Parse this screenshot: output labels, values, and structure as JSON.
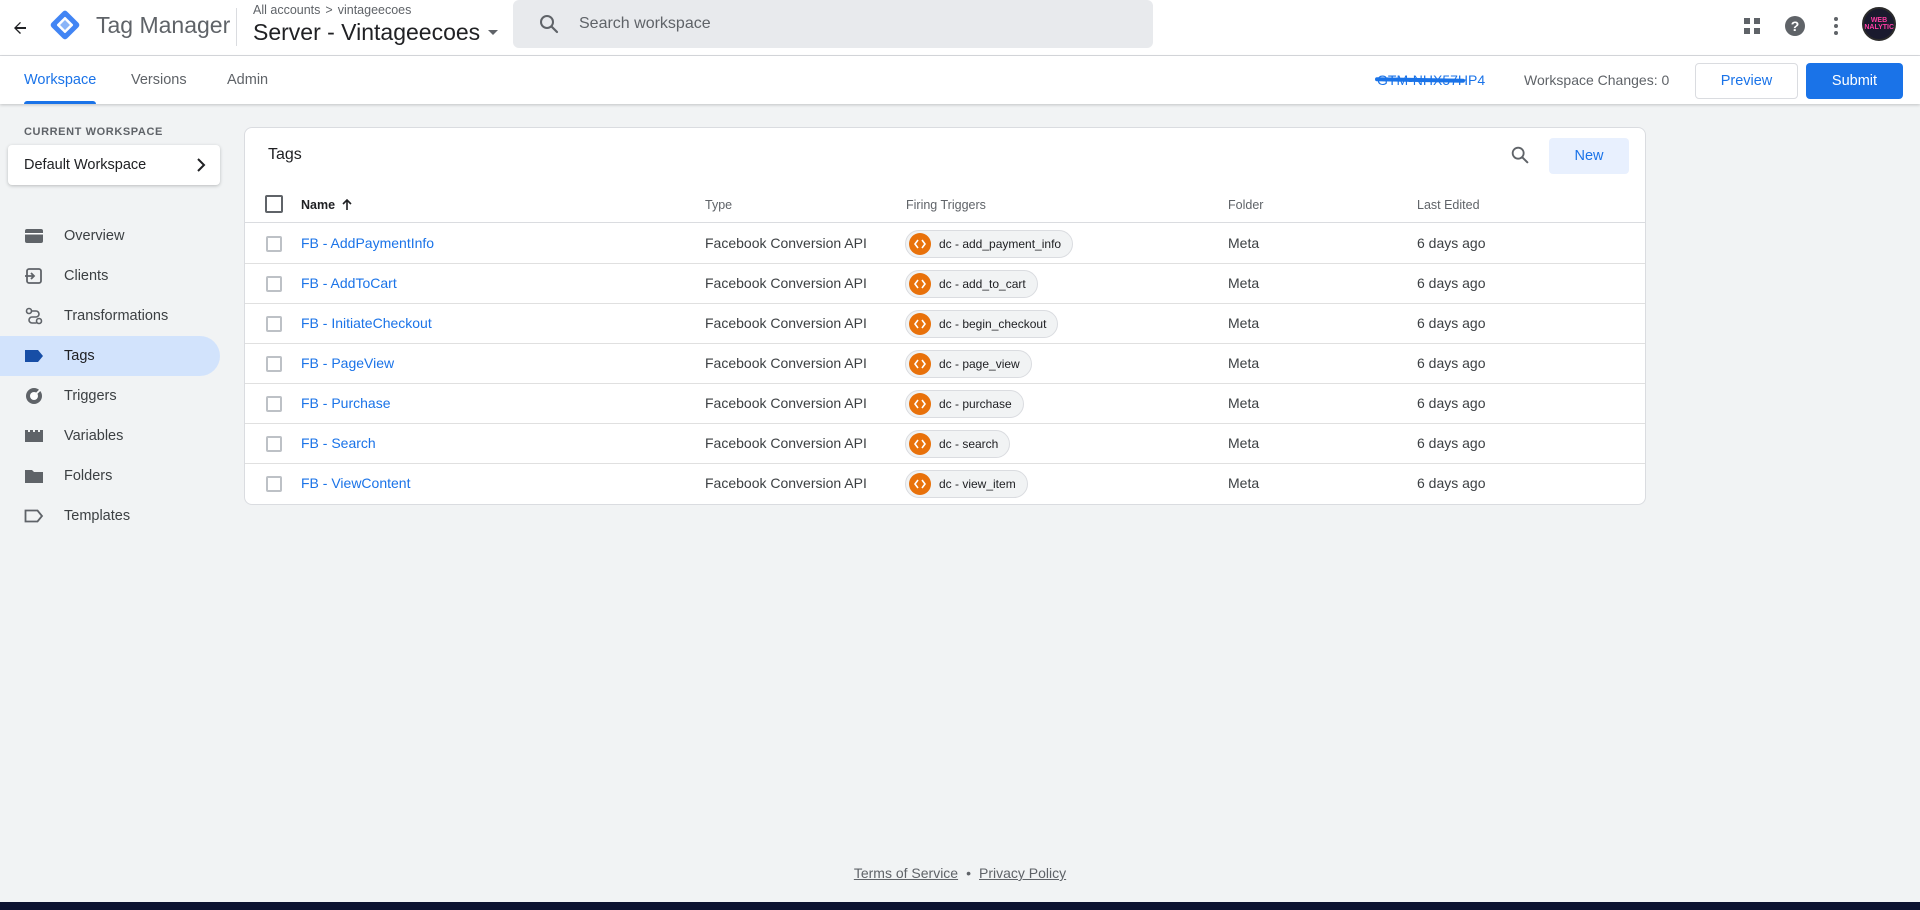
{
  "header": {
    "product_name": "Tag Manager",
    "breadcrumb": {
      "root": "All accounts",
      "separator": ">",
      "account": "vintageecoes"
    },
    "container_name": "Server - Vintageecoes",
    "search_placeholder": "Search workspace",
    "avatar_text": "WEB ANALYTICS"
  },
  "subnav": {
    "tabs": [
      {
        "label": "Workspace",
        "active": true
      },
      {
        "label": "Versions",
        "active": false
      },
      {
        "label": "Admin",
        "active": false
      }
    ],
    "container_id": "GTM-NHX57HP4",
    "workspace_changes": "Workspace Changes: 0",
    "preview_label": "Preview",
    "submit_label": "Submit"
  },
  "sidebar": {
    "current_workspace_label": "CURRENT WORKSPACE",
    "workspace_name": "Default Workspace",
    "items": [
      {
        "label": "Overview",
        "icon": "overview-icon",
        "active": false
      },
      {
        "label": "Clients",
        "icon": "clients-icon",
        "active": false
      },
      {
        "label": "Transformations",
        "icon": "transformations-icon",
        "active": false
      },
      {
        "label": "Tags",
        "icon": "tag-icon",
        "active": true
      },
      {
        "label": "Triggers",
        "icon": "triggers-icon",
        "active": false
      },
      {
        "label": "Variables",
        "icon": "variables-icon",
        "active": false
      },
      {
        "label": "Folders",
        "icon": "folder-icon",
        "active": false
      },
      {
        "label": "Templates",
        "icon": "templates-icon",
        "active": false
      }
    ]
  },
  "tags": {
    "title": "Tags",
    "new_label": "New",
    "columns": {
      "name": "Name",
      "type": "Type",
      "firing_triggers": "Firing Triggers",
      "folder": "Folder",
      "last_edited": "Last Edited"
    },
    "rows": [
      {
        "name": "FB - AddPaymentInfo",
        "type": "Facebook Conversion API",
        "trigger": "dc - add_payment_info",
        "folder": "Meta",
        "last_edited": "6 days ago"
      },
      {
        "name": "FB - AddToCart",
        "type": "Facebook Conversion API",
        "trigger": "dc - add_to_cart",
        "folder": "Meta",
        "last_edited": "6 days ago"
      },
      {
        "name": "FB - InitiateCheckout",
        "type": "Facebook Conversion API",
        "trigger": "dc - begin_checkout",
        "folder": "Meta",
        "last_edited": "6 days ago"
      },
      {
        "name": "FB - PageView",
        "type": "Facebook Conversion API",
        "trigger": "dc - page_view",
        "folder": "Meta",
        "last_edited": "6 days ago"
      },
      {
        "name": "FB - Purchase",
        "type": "Facebook Conversion API",
        "trigger": "dc - purchase",
        "folder": "Meta",
        "last_edited": "6 days ago"
      },
      {
        "name": "FB - Search",
        "type": "Facebook Conversion API",
        "trigger": "dc - search",
        "folder": "Meta",
        "last_edited": "6 days ago"
      },
      {
        "name": "FB - ViewContent",
        "type": "Facebook Conversion API",
        "trigger": "dc - view_item",
        "folder": "Meta",
        "last_edited": "6 days ago"
      }
    ]
  },
  "footer": {
    "terms": "Terms of Service",
    "separator": "•",
    "privacy": "Privacy Policy"
  },
  "colors": {
    "accent": "#1a73e8",
    "trigger_icon": "#e8710a",
    "active_nav": "#d2e3fc",
    "background": "#f1f3f4"
  }
}
